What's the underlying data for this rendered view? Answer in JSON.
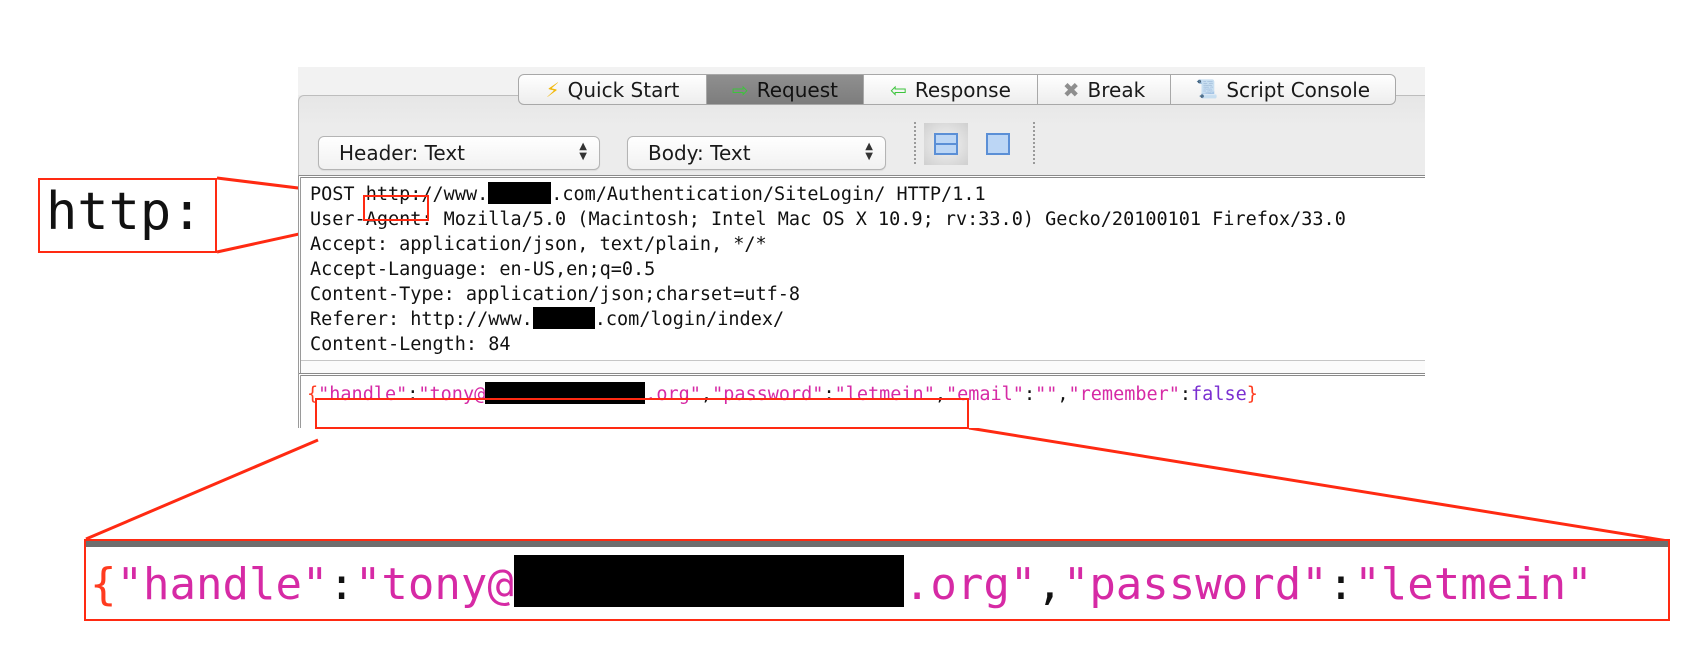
{
  "tabs": [
    {
      "label": "Quick Start",
      "icon": "lightning-icon",
      "glyph": "⚡",
      "active": false
    },
    {
      "label": "Request",
      "icon": "arrow-right-icon",
      "glyph": "⇨",
      "active": true
    },
    {
      "label": "Response",
      "icon": "arrow-left-icon",
      "glyph": "⇦",
      "active": false
    },
    {
      "label": "Break",
      "icon": "x-icon",
      "glyph": "✖",
      "active": false
    },
    {
      "label": "Script Console",
      "icon": "scroll-icon",
      "glyph": "📜",
      "active": false
    }
  ],
  "toolbar": {
    "header_select": "Header: Text",
    "body_select": "Body: Text",
    "view_buttons": [
      {
        "name": "split-view",
        "active": true
      },
      {
        "name": "single-view",
        "active": false
      }
    ]
  },
  "request_header": {
    "lines": [
      {
        "pre": "POST ",
        "highlight": "http:",
        "post1": "//www.",
        "redacted": true,
        "post2": ".com/Authentication/SiteLogin/ HTTP/1.1"
      },
      {
        "text": "User-Agent: Mozilla/5.0 (Macintosh; Intel Mac OS X 10.9; rv:33.0) Gecko/20100101 Firefox/33.0"
      },
      {
        "text": "Accept: application/json, text/plain, */*"
      },
      {
        "text": "Accept-Language: en-US,en;q=0.5"
      },
      {
        "text": "Content-Type: application/json;charset=utf-8"
      },
      {
        "pre": "Referer: http://www.",
        "redacted": true,
        "post2": ".com/login/index/"
      },
      {
        "text": "Content-Length: 84"
      }
    ]
  },
  "request_body": {
    "open_brace": "{",
    "handle_key": "\"handle\"",
    "colon": ":",
    "handle_val_start": "\"tony@",
    "handle_val_end": ".org\"",
    "comma": ",",
    "password_key": "\"password\"",
    "password_val": "\"letmein\"",
    "email_key": "\"email\"",
    "email_val": "\"\"",
    "remember_key": "\"remember\"",
    "remember_val": "false",
    "close_brace": "}"
  },
  "annotations": {
    "zoom_http_text": "http:",
    "highlight_color": "#ff2a12"
  },
  "colors": {
    "json_string": "#d62aa5",
    "json_brace": "#ff3b1f",
    "json_bool": "#7a2fd1",
    "active_tab": "#868686"
  }
}
